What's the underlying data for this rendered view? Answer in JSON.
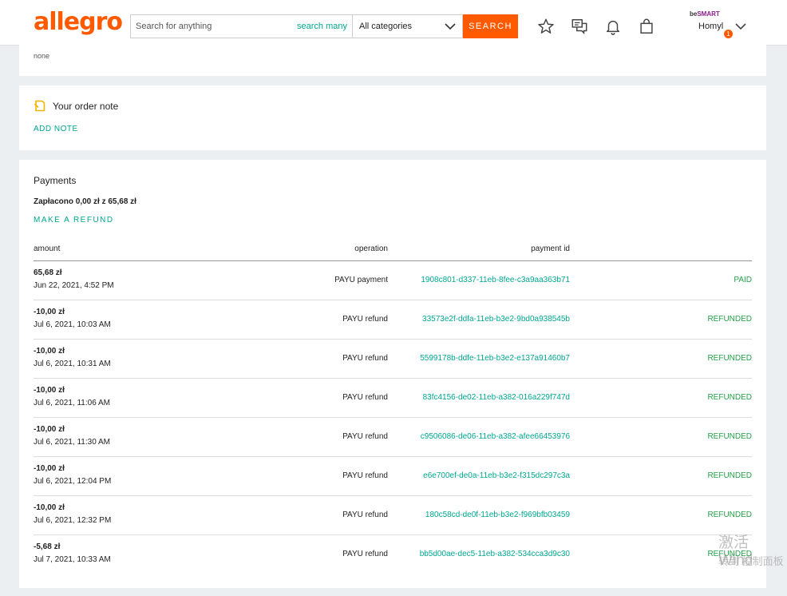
{
  "header": {
    "logo": "allegro",
    "search_placeholder": "Search for anything",
    "search_many": "search many",
    "category": "All categories",
    "search_button": "SEARCH",
    "smart_prefix": "be",
    "smart_brand": "SMART",
    "user_name": "Homyl",
    "notification_count": "1"
  },
  "top_card": {
    "text": "none"
  },
  "order_note": {
    "title": "Your order note",
    "add_note": "ADD NOTE"
  },
  "payments": {
    "title": "Payments",
    "summary": "Zapłacono 0,00 zł z 65,68 zł",
    "refund_link": "MAKE A REFUND",
    "headers": {
      "amount": "amount",
      "operation": "operation",
      "payment_id": "payment id"
    },
    "rows": [
      {
        "amount": "65,68 zł",
        "date": "Jun 22, 2021, 4:52 PM",
        "operation": "PAYU payment",
        "payment_id": "1908c801-d337-11eb-8fee-c3a9aa363b71",
        "status": "PAID"
      },
      {
        "amount": "-10,00 zł",
        "date": "Jul 6, 2021, 10:03 AM",
        "operation": "PAYU refund",
        "payment_id": "33573e2f-ddfa-11eb-b3e2-9bd0a938545b",
        "status": "REFUNDED"
      },
      {
        "amount": "-10,00 zł",
        "date": "Jul 6, 2021, 10:31 AM",
        "operation": "PAYU refund",
        "payment_id": "5599178b-ddfe-11eb-b3e2-e137a91460b7",
        "status": "REFUNDED"
      },
      {
        "amount": "-10,00 zł",
        "date": "Jul 6, 2021, 11:06 AM",
        "operation": "PAYU refund",
        "payment_id": "83fc4156-de02-11eb-a382-016a229f747d",
        "status": "REFUNDED"
      },
      {
        "amount": "-10,00 zł",
        "date": "Jul 6, 2021, 11:30 AM",
        "operation": "PAYU refund",
        "payment_id": "c9506086-de06-11eb-a382-afee66453976",
        "status": "REFUNDED"
      },
      {
        "amount": "-10,00 zł",
        "date": "Jul 6, 2021, 12:04 PM",
        "operation": "PAYU refund",
        "payment_id": "e6e700ef-de0a-11eb-b3e2-f315dc297c3a",
        "status": "REFUNDED"
      },
      {
        "amount": "-10,00 zł",
        "date": "Jul 6, 2021, 12:32 PM",
        "operation": "PAYU refund",
        "payment_id": "180c58cd-de0f-11eb-b3e2-f969bfb03459",
        "status": "REFUNDED"
      },
      {
        "amount": "-5,68 zł",
        "date": "Jul 7, 2021, 10:33 AM",
        "operation": "PAYU refund",
        "payment_id": "bb5d00ae-dec5-11eb-a382-534cca3d9c30",
        "status": "REFUNDED"
      }
    ]
  },
  "watermark": {
    "line1": "激活 Wind",
    "line2": "转到 控制面板"
  },
  "colors": {
    "brand": "#ff5a00",
    "link": "#00a790",
    "status": "#24a148"
  }
}
